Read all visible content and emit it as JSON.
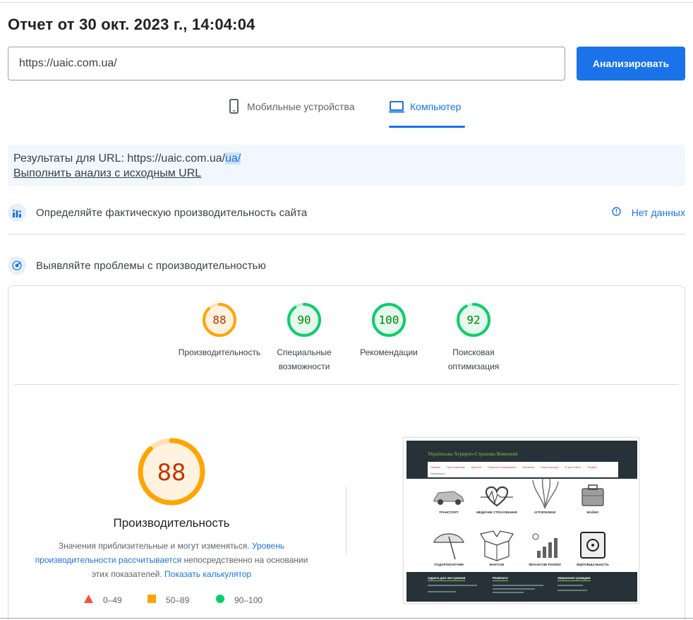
{
  "report": {
    "title": "Отчет от 30 окт. 2023 г., 14:04:04"
  },
  "search": {
    "url_value": "https://uaic.com.ua/",
    "analyze_label": "Анализировать"
  },
  "device_tabs": {
    "mobile": "Мобильные устройства",
    "desktop": "Компьютер",
    "active": "desktop"
  },
  "url_info": {
    "prefix": "Результаты для URL: https://uaic.com.ua/",
    "highlight": "ua/",
    "original_link": "Выполнить анализ с исходным URL"
  },
  "field_data": {
    "title": "Определяйте фактическую производительность сайта",
    "no_data": "Нет данных"
  },
  "lab_data": {
    "title": "Выявляйте проблемы с производительностью"
  },
  "scores": [
    {
      "value": "88",
      "label1": "Производительность",
      "label2": "",
      "level": "average"
    },
    {
      "value": "90",
      "label1": "Специальные",
      "label2": "возможности",
      "level": "pass"
    },
    {
      "value": "100",
      "label1": "Рекомендации",
      "label2": "",
      "level": "pass"
    },
    {
      "value": "92",
      "label1": "Поисковая",
      "label2": "оптимизация",
      "level": "pass"
    }
  ],
  "performance": {
    "score": "88",
    "title": "Производительность",
    "desc_part1": "Значения приблизительные и могут изменяться.",
    "desc_link1": "Уровень производительности рассчитывается",
    "desc_part2": "непосредственно на основании этих показателей.",
    "desc_link2": "Показать калькулятор"
  },
  "legend": {
    "fail": "0–49",
    "average": "50–89",
    "pass": "90–100"
  },
  "colors": {
    "accent": "#1a73e8",
    "pass": "#0cce6b",
    "average": "#ffa400",
    "fail": "#ff4e42",
    "pass_text": "#008800",
    "average_text": "#c33300"
  },
  "screenshot": {
    "brand": "Українська Аграрно-Страхова Компанія",
    "nav": [
      "Новини",
      "Про компанію",
      "Кар'єра",
      "Правила страхування",
      "Контакти",
      "Наші послуги",
      "Я уже клієнт",
      "English",
      "Українська"
    ],
    "products": [
      "ТРАНСПОРТ",
      "МЕДИЧНЕ СТРАХУВАННЯ",
      "АГРОРИЗИКИ",
      "МАЙНО",
      "ПОДОРОЖУЮЧИМ",
      "ВАНТАЖІ",
      "ФІНАНСОВІ РИЗИКИ",
      "ВІДПОВІДАЛЬНІСТЬ"
    ],
    "footer": [
      "Адреса для листування",
      "Реквізити",
      "Звернення громадян"
    ]
  }
}
